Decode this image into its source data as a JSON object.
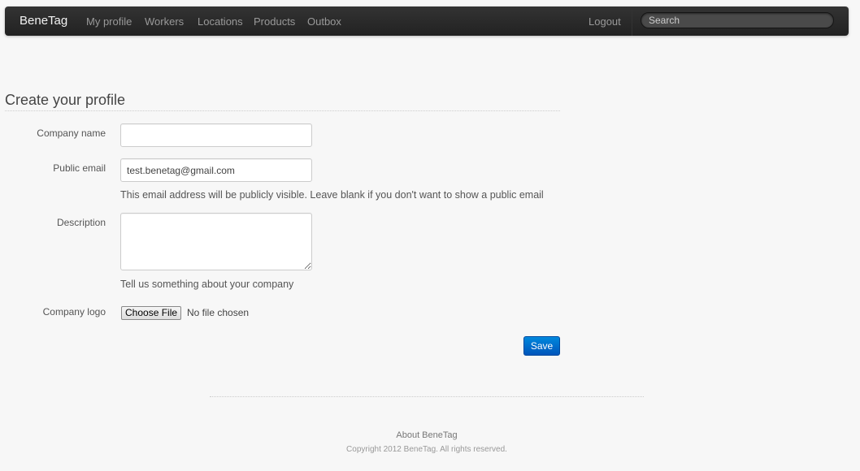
{
  "navbar": {
    "brand": "BeneTag",
    "links": [
      "My profile",
      "Workers",
      "Locations",
      "Products",
      "Outbox"
    ],
    "logout": "Logout",
    "search_placeholder": "Search"
  },
  "page": {
    "title": "Create your profile"
  },
  "form": {
    "company_name": {
      "label": "Company name",
      "value": ""
    },
    "public_email": {
      "label": "Public email",
      "value": "test.benetag@gmail.com",
      "help": "This email address will be publicly visible. Leave blank if you don't want to show a public email"
    },
    "description": {
      "label": "Description",
      "value": "",
      "help": "Tell us something about your company"
    },
    "company_logo": {
      "label": "Company logo",
      "button": "Choose File",
      "status": "No file chosen"
    },
    "save": "Save"
  },
  "footer": {
    "about": "About BeneTag",
    "copyright": "Copyright 2012 BeneTag. All rights reserved."
  }
}
